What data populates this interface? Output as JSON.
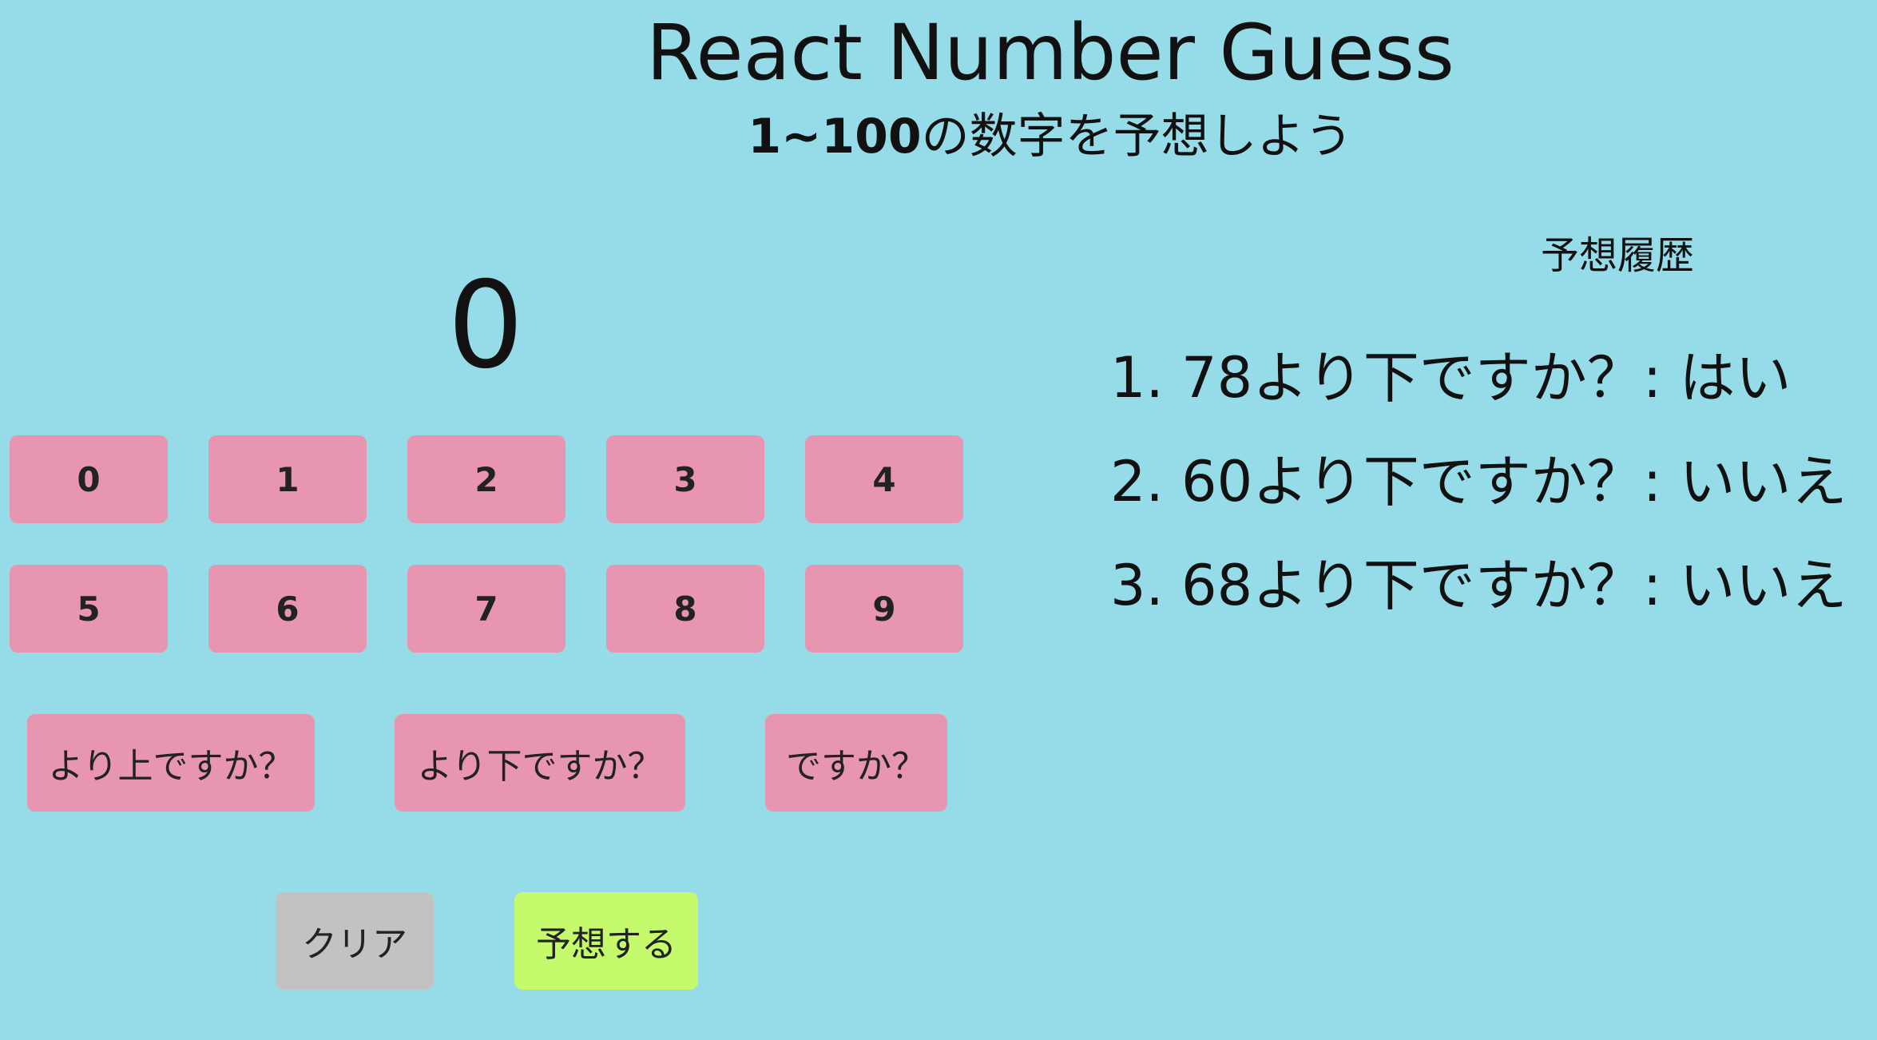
{
  "app": {
    "title": "React Number Guess",
    "subtitle_range": "1~100",
    "subtitle_text": "の数字を予想しよう"
  },
  "display": {
    "value": "0"
  },
  "keypad": {
    "digits": [
      "0",
      "1",
      "2",
      "3",
      "4",
      "5",
      "6",
      "7",
      "8",
      "9"
    ]
  },
  "question_buttons": {
    "higher": "より上ですか？",
    "lower": "より下ですか？",
    "equal": "ですか？"
  },
  "controls": {
    "clear": "クリア",
    "guess": "予想する"
  },
  "history": {
    "title": "予想履歴",
    "items": [
      "1. 78より下ですか？: はい",
      "2. 60より下ですか？: いいえ",
      "3. 68より下ですか？: いいえ"
    ]
  },
  "colors": {
    "background": "#96dbe8",
    "button_pink": "#e895b2",
    "button_gray": "#c2c2c2",
    "button_lime": "#c4fa6c",
    "text": "#111111"
  }
}
